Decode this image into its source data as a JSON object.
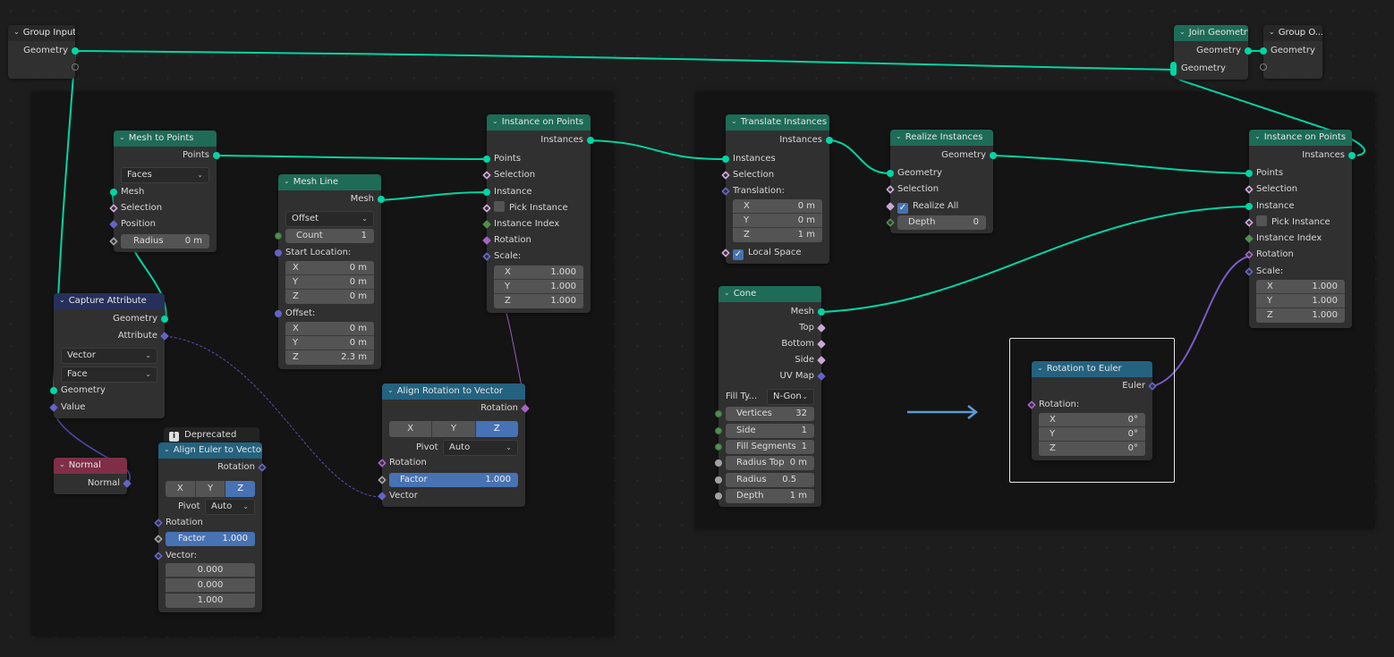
{
  "colors": {
    "geometry_link": "#00d6a3",
    "vector_link": "#6363c7",
    "rotation_link": "#a663c7",
    "arrow": "#5b9bd5"
  },
  "group_input": {
    "title": "Group Input",
    "outputs": [
      "Geometry"
    ]
  },
  "join_geometry": {
    "title": "Join Geometry",
    "output": "Geometry",
    "input": "Geometry"
  },
  "group_output": {
    "title": "Group O...",
    "input": "Geometry"
  },
  "mesh_to_points": {
    "title": "Mesh to Points",
    "output": "Points",
    "mode": "Faces",
    "inputs": [
      "Mesh",
      "Selection",
      "Position"
    ],
    "radius_label": "Radius",
    "radius_value": "0 m"
  },
  "mesh_line": {
    "title": "Mesh Line",
    "output": "Mesh",
    "mode": "Offset",
    "count_label": "Count",
    "count_value": "1",
    "start_location_label": "Start Location:",
    "start_location": [
      {
        "axis": "X",
        "value": "0 m"
      },
      {
        "axis": "Y",
        "value": "0 m"
      },
      {
        "axis": "Z",
        "value": "0 m"
      }
    ],
    "offset_label": "Offset:",
    "offset": [
      {
        "axis": "X",
        "value": "0 m"
      },
      {
        "axis": "Y",
        "value": "0 m"
      },
      {
        "axis": "Z",
        "value": "2.3 m"
      }
    ]
  },
  "instance_on_points_1": {
    "title": "Instance on Points",
    "output": "Instances",
    "inputs": [
      "Points",
      "Selection",
      "Instance",
      "Pick Instance",
      "Instance Index",
      "Rotation",
      "Scale:"
    ],
    "pick_instance_checked": false,
    "scale": [
      {
        "axis": "X",
        "value": "1.000"
      },
      {
        "axis": "Y",
        "value": "1.000"
      },
      {
        "axis": "Z",
        "value": "1.000"
      }
    ]
  },
  "capture_attribute": {
    "title": "Capture Attribute",
    "outputs": [
      "Geometry",
      "Attribute"
    ],
    "data_type": "Vector",
    "domain": "Face",
    "inputs": [
      "Geometry",
      "Value"
    ]
  },
  "normal": {
    "title": "Normal",
    "output": "Normal"
  },
  "align_euler": {
    "badge": "Deprecated",
    "title": "Align Euler to Vector",
    "output": "Rotation",
    "axes": [
      "X",
      "Y",
      "Z"
    ],
    "active_axis": "Z",
    "pivot_label": "Pivot",
    "pivot_value": "Auto",
    "rotation_label": "Rotation",
    "factor_label": "Factor",
    "factor_value": "1.000",
    "vector_label": "Vector:",
    "vector": [
      "0.000",
      "0.000",
      "1.000"
    ]
  },
  "align_rotation": {
    "title": "Align Rotation to Vector",
    "output": "Rotation",
    "axes": [
      "X",
      "Y",
      "Z"
    ],
    "active_axis": "Z",
    "pivot_label": "Pivot",
    "pivot_value": "Auto",
    "rotation_label": "Rotation",
    "factor_label": "Factor",
    "factor_value": "1.000",
    "vector_label": "Vector"
  },
  "translate_instances": {
    "title": "Translate Instances",
    "output": "Instances",
    "inputs": [
      "Instances",
      "Selection",
      "Translation:"
    ],
    "translation": [
      {
        "axis": "X",
        "value": "0 m"
      },
      {
        "axis": "Y",
        "value": "0 m"
      },
      {
        "axis": "Z",
        "value": "1 m"
      }
    ],
    "local_space_label": "Local Space",
    "local_space_checked": true
  },
  "realize_instances": {
    "title": "Realize Instances",
    "output": "Geometry",
    "inputs": [
      "Geometry",
      "Selection"
    ],
    "realize_all_label": "Realize All",
    "realize_all_checked": true,
    "depth_label": "Depth",
    "depth_value": "0"
  },
  "cone": {
    "title": "Cone",
    "outputs": [
      "Mesh",
      "Top",
      "Bottom",
      "Side",
      "UV Map"
    ],
    "fill_type_label": "Fill Ty...",
    "fill_type_value": "N-Gon",
    "fields": [
      {
        "label": "Vertices",
        "value": "32"
      },
      {
        "label": "Side Segments",
        "value": "1"
      },
      {
        "label": "Fill Segments",
        "value": "1"
      },
      {
        "label": "Radius Top",
        "value": "0 m"
      },
      {
        "label": "Radius B...",
        "value": "0.5 m"
      },
      {
        "label": "Depth",
        "value": "1 m"
      }
    ]
  },
  "instance_on_points_2": {
    "title": "Instance on Points",
    "output": "Instances",
    "inputs": [
      "Points",
      "Selection",
      "Instance",
      "Pick Instance",
      "Instance Index",
      "Rotation",
      "Scale:"
    ],
    "pick_instance_checked": false,
    "scale": [
      {
        "axis": "X",
        "value": "1.000"
      },
      {
        "axis": "Y",
        "value": "1.000"
      },
      {
        "axis": "Z",
        "value": "1.000"
      }
    ]
  },
  "rotation_to_euler": {
    "title": "Rotation to Euler",
    "output": "Euler",
    "input_label": "Rotation:",
    "rotation": [
      {
        "axis": "X",
        "value": "0°"
      },
      {
        "axis": "Y",
        "value": "0°"
      },
      {
        "axis": "Z",
        "value": "0°"
      }
    ]
  },
  "icons": {
    "collapse": "chevron-down-icon",
    "info": "info-icon",
    "arrow": "arrow-right-icon",
    "check": "checkmark-icon"
  }
}
